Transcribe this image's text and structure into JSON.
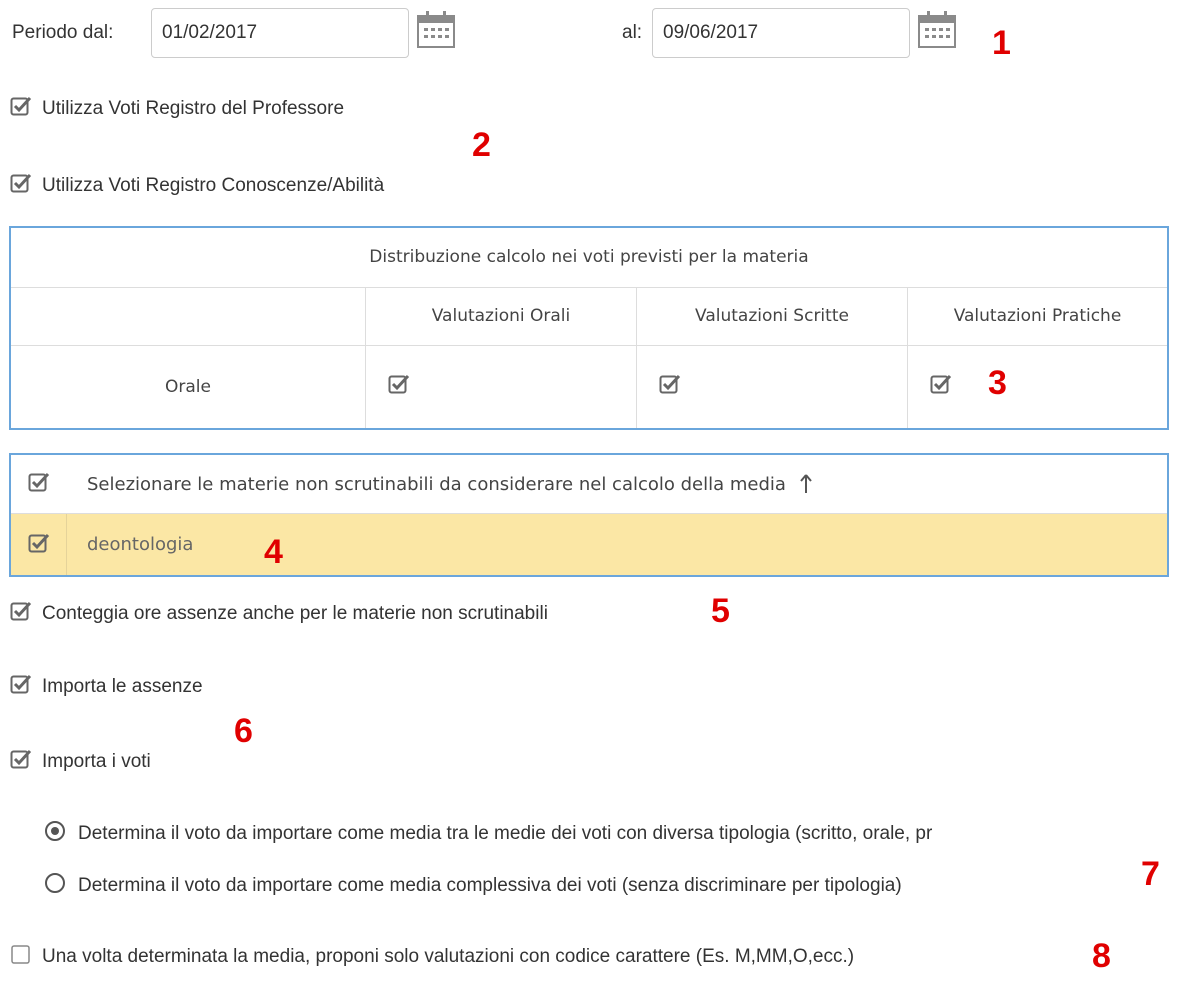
{
  "period": {
    "from_label": "Periodo dal:",
    "from_value": "01/02/2017",
    "to_label": "al:",
    "to_value": "09/06/2017"
  },
  "options": {
    "use_teacher_register": {
      "label": "Utilizza Voti Registro del Professore",
      "checked": true
    },
    "use_knowledge_register": {
      "label": "Utilizza Voti Registro Conoscenze/Abilità",
      "checked": true
    }
  },
  "distribution_table": {
    "title": "Distribuzione calcolo nei voti previsti per la materia",
    "columns": [
      "",
      "Valutazioni Orali",
      "Valutazioni Scritte",
      "Valutazioni Pratiche"
    ],
    "rows": [
      {
        "label": "Orale",
        "orali": true,
        "scritte": true,
        "pratiche": true
      }
    ]
  },
  "non_scrutinable_subjects": {
    "header": "Selezionare le materie non scrutinabili da considerare nel calcolo della media",
    "sort_icon": "arrow-up-icon",
    "items": [
      {
        "label": "deontologia",
        "checked": true
      }
    ]
  },
  "count_absences": {
    "label": "Conteggia ore assenze anche per le materie non scrutinabili",
    "checked": true
  },
  "import_absences": {
    "label": "Importa le assenze",
    "checked": true
  },
  "import_grades": {
    "label": "Importa i voti",
    "checked": true
  },
  "grade_mode": {
    "selected": 0,
    "options": [
      "Determina il voto da importare come media tra le medie dei voti con diversa tipologia (scritto, orale, pr",
      "Determina il voto da importare come media complessiva dei voti (senza discriminare per tipologia)"
    ]
  },
  "char_code_only": {
    "label": "Una volta determinata la media, proponi solo valutazioni con codice carattere (Es. M,MM,O,ecc.)",
    "checked": false
  },
  "markers": [
    "1",
    "2",
    "3",
    "4",
    "5",
    "6",
    "7",
    "8"
  ],
  "colors": {
    "accent_border": "#6aa6dc",
    "highlight_row": "#fbe7a5",
    "marker_red": "#e00000"
  }
}
